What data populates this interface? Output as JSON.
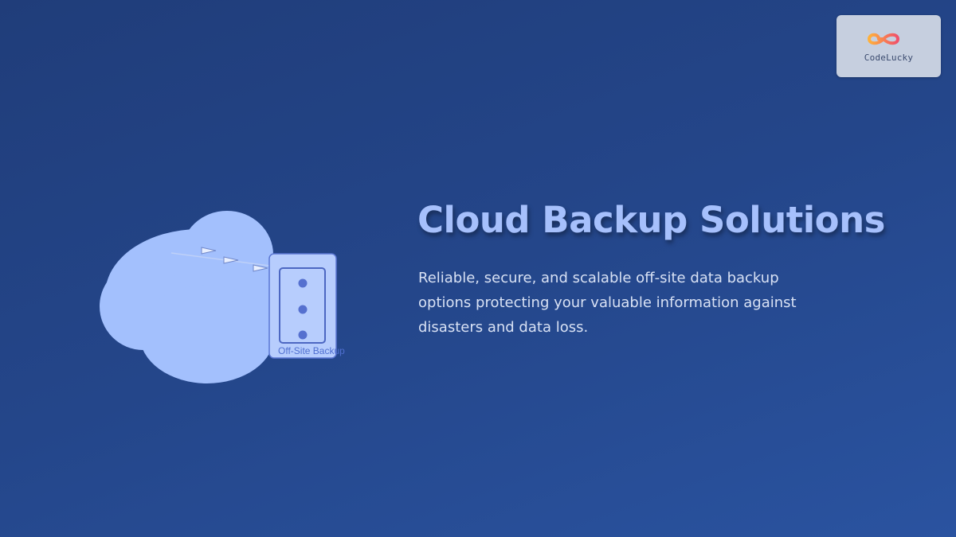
{
  "brand": {
    "name": "CodeLucky",
    "logo_icon": "infinity-logo-icon"
  },
  "hero": {
    "title": "Cloud Backup Solutions",
    "description": "Reliable, secure, and scalable off-site data backup options protecting your valuable information against disasters and data loss."
  },
  "illustration": {
    "server_label": "Off-Site Backup",
    "icons": [
      "cloud-icon",
      "server-icon",
      "arrow-icon"
    ]
  },
  "colors": {
    "background_start": "#203d7a",
    "background_end": "#2a53a0",
    "cloud": "#a3c0fd",
    "server_fill": "#b7cdfd",
    "server_stroke": "#5b77d3",
    "server_dot": "#5570cf",
    "title": "#a6c0fc",
    "description": "#d8e1f4",
    "badge_bg": "#c6cfdf"
  }
}
